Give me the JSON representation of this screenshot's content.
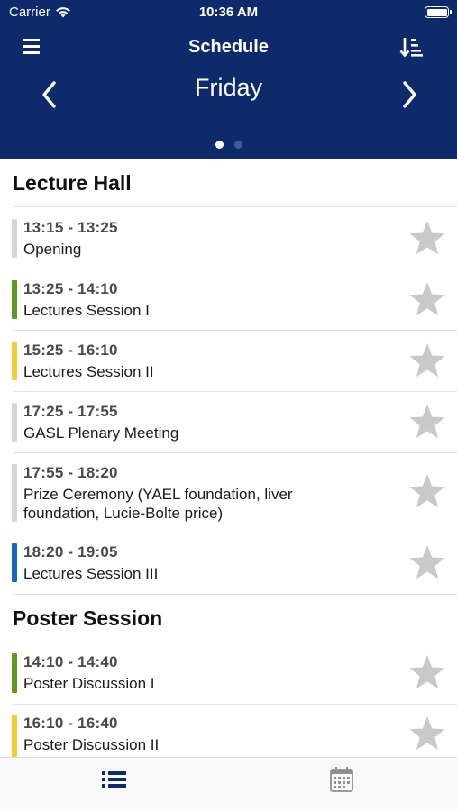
{
  "status_bar": {
    "carrier": "Carrier",
    "time": "10:36 AM",
    "wifi_icon": "wifi-icon",
    "battery_icon": "battery-icon"
  },
  "nav": {
    "title": "Schedule",
    "day": "Friday",
    "menu_icon": "hamburger-menu-icon",
    "sort_icon": "sort-icon",
    "prev_icon": "chevron-left-icon",
    "next_icon": "chevron-right-icon",
    "page_count": 2,
    "active_page": 1
  },
  "sections": [
    {
      "title": "Lecture Hall",
      "items": [
        {
          "time": "13:15 - 13:25",
          "title": "Opening",
          "color": "#d6d6d6"
        },
        {
          "time": "13:25 - 14:10",
          "title": "Lectures Session I",
          "color": "#5e9a1e"
        },
        {
          "time": "15:25 - 16:10",
          "title": "Lectures Session II",
          "color": "#f4cb37"
        },
        {
          "time": "17:25 - 17:55",
          "title": "GASL Plenary Meeting",
          "color": "#d6d6d6"
        },
        {
          "time": "17:55 - 18:20",
          "title_lines": [
            "Prize Ceremony (YAEL foundation, liver",
            "foundation, Lucie-Bolte price)"
          ],
          "color": "#d6d6d6"
        },
        {
          "time": "18:20 - 19:05",
          "title": "Lectures Session III",
          "color": "#1766c3"
        }
      ]
    },
    {
      "title": "Poster Session",
      "items": [
        {
          "time": "14:10 - 14:40",
          "title": "Poster Discussion I",
          "color": "#5e9a1e"
        },
        {
          "time": "16:10 - 16:40",
          "title": "Poster Discussion II",
          "color": "#f4cb37"
        }
      ]
    }
  ],
  "star_icon": "star-icon",
  "tabs": [
    {
      "icon": "list-icon",
      "selected": true
    },
    {
      "icon": "calendar-icon",
      "selected": false
    }
  ],
  "colors": {
    "header_bg": "#0d2b6b",
    "star": "#c9c9c9",
    "tab_active": "#0d2b6b",
    "tab_inactive": "#8e8e93"
  }
}
